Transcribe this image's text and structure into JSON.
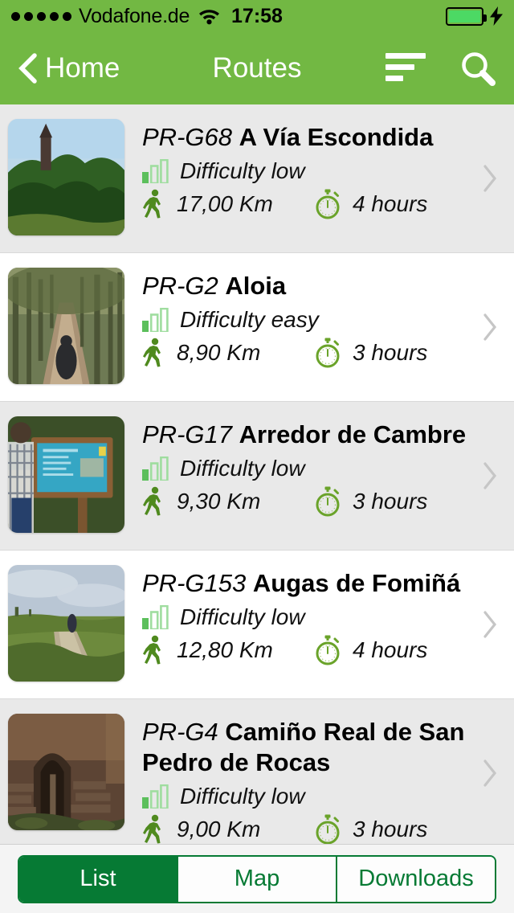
{
  "status_bar": {
    "signal_dots": 5,
    "carrier": "Vodafone.de",
    "wifi_icon": "wifi-icon",
    "time": "17:58",
    "battery_icon": "battery-icon",
    "charging_icon": "lightning-bolt-icon"
  },
  "nav_bar": {
    "back_icon": "chevron-left-icon",
    "back_label": "Home",
    "title": "Routes",
    "sort_icon": "sort-icon",
    "search_icon": "search-icon",
    "background_color": "#72b843"
  },
  "routes": [
    {
      "code": "PR-G68",
      "name": "A Vía Escondida",
      "difficulty": "Difficulty low",
      "difficulty_level": 1,
      "distance": "17,00 Km",
      "duration": "4 hours",
      "thumb": "church-trees-photo",
      "chevron_icon": "chevron-right-icon"
    },
    {
      "code": "PR-G2",
      "name": "Aloia",
      "difficulty": "Difficulty easy",
      "difficulty_level": 1,
      "distance": "8,90 Km",
      "duration": "3 hours",
      "thumb": "forest-path-photo",
      "chevron_icon": "chevron-right-icon"
    },
    {
      "code": "PR-G17",
      "name": "Arredor de Cambre",
      "difficulty": "Difficulty low",
      "difficulty_level": 1,
      "distance": "9,30 Km",
      "duration": "3 hours",
      "thumb": "information-sign-photo",
      "chevron_icon": "chevron-right-icon"
    },
    {
      "code": "PR-G153",
      "name": "Augas de Fomiñá",
      "difficulty": "Difficulty low",
      "difficulty_level": 1,
      "distance": "12,80 Km",
      "duration": "4 hours",
      "thumb": "meadow-track-photo",
      "chevron_icon": "chevron-right-icon"
    },
    {
      "code": "PR-G4",
      "name": "Camiño Real de San Pedro de Rocas",
      "difficulty": "Difficulty low",
      "difficulty_level": 1,
      "distance": "9,00 Km",
      "duration": "3 hours",
      "thumb": "stone-arch-photo",
      "chevron_icon": "chevron-right-icon"
    }
  ],
  "tab_bar": {
    "segments": [
      {
        "label": "List",
        "active": true
      },
      {
        "label": "Map",
        "active": false
      },
      {
        "label": "Downloads",
        "active": false
      }
    ],
    "accent_color": "#067a34"
  },
  "icon_colors": {
    "difficulty_filled": "#5cbf5c",
    "difficulty_empty": "#9fdd9f",
    "walker": "#4f8a1e",
    "stopwatch": "#6aa32a",
    "chevron": "#c6c6c6"
  }
}
